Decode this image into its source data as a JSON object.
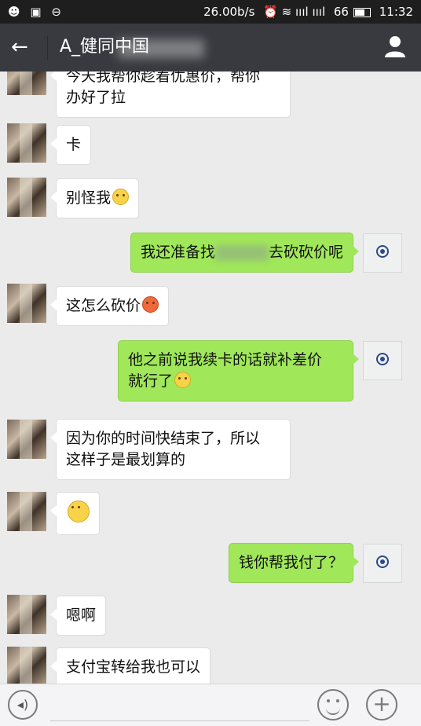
{
  "status_bar": {
    "left_icons": "☻ ▣ ⊖",
    "network_speed": "26.00b/s",
    "signal": "⏰ ≋ ıııl ıııl",
    "battery_level": "66",
    "time": "11:32"
  },
  "header": {
    "back_icon": "back-arrow-icon",
    "title": "A_健同中国",
    "profile_icon": "person-icon"
  },
  "messages": [
    {
      "side": "other",
      "lines": [
        "今天我帮你趁着优惠价，帮你",
        "办好了拉"
      ]
    },
    {
      "side": "other",
      "lines": [
        "卡"
      ]
    },
    {
      "side": "other",
      "lines": [
        "别怪我"
      ],
      "emoji": "embarrassed-emoji"
    },
    {
      "side": "me",
      "text_a": "我还准备找",
      "text_b": "去砍砍价呢"
    },
    {
      "side": "other",
      "lines": [
        "这怎么砍价"
      ],
      "emoji": "angry-emoji"
    },
    {
      "side": "me",
      "lines": [
        "他之前说我续卡的话就补差价",
        "就行了"
      ],
      "emoji": "embarrassed-emoji"
    },
    {
      "side": "other",
      "lines": [
        "因为你的时间快结束了，所以",
        "这样子是最划算的"
      ]
    },
    {
      "side": "other",
      "emoji": "grin-emoji"
    },
    {
      "side": "me",
      "lines": [
        "钱你帮我付了？"
      ]
    },
    {
      "side": "other",
      "lines": [
        "嗯啊"
      ]
    },
    {
      "side": "other",
      "lines": [
        "支付宝转给我也可以"
      ]
    }
  ],
  "bottom_bar": {
    "voice_icon": "voice-icon",
    "voice_symbol": "◂)",
    "emoji_icon": "smiley-icon",
    "plus_icon": "plus-icon",
    "plus_symbol": "+"
  },
  "colors": {
    "status_bar": "#1e1e1e",
    "header": "#393a3f",
    "chat_bg": "#ebebeb",
    "my_bubble": "#a0e75a",
    "other_bubble": "#ffffff"
  }
}
